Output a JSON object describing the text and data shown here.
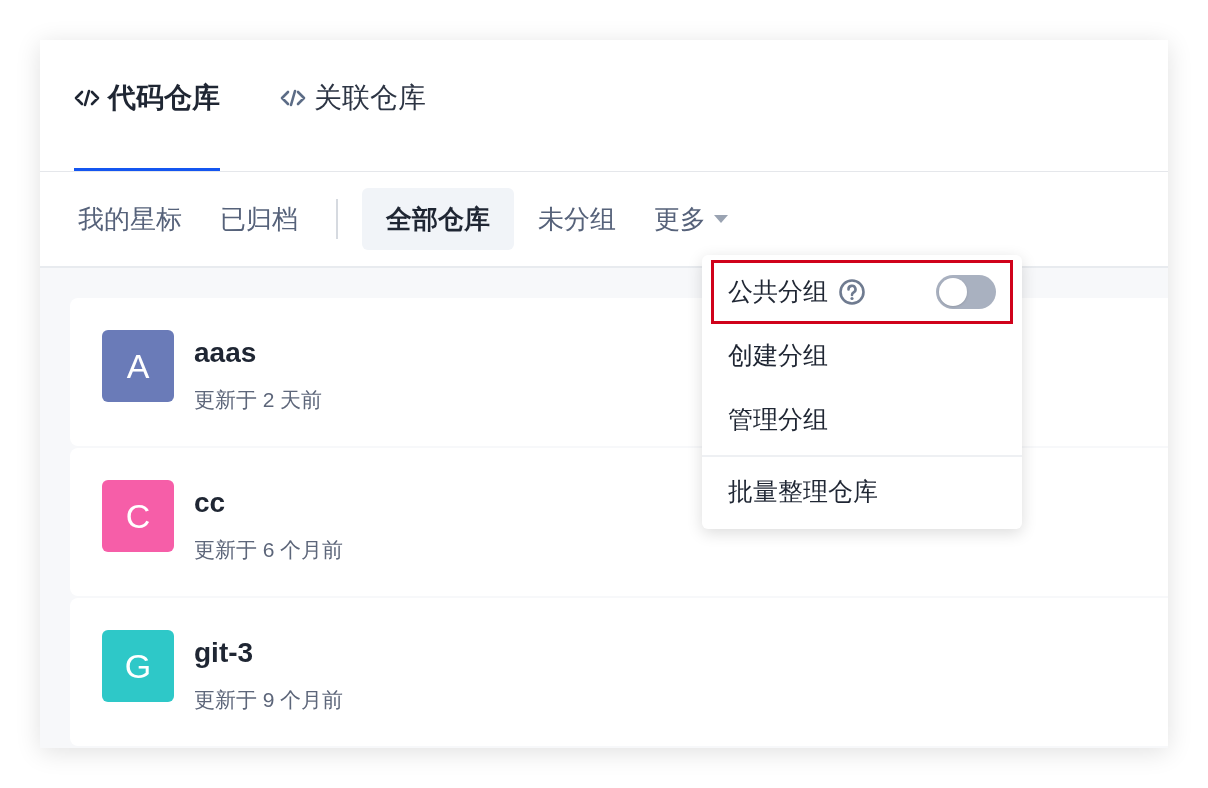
{
  "tabs": [
    {
      "label": "代码仓库",
      "selected": true
    },
    {
      "label": "关联仓库",
      "selected": false
    }
  ],
  "filters": [
    {
      "label": "我的星标",
      "selected": false,
      "kind": "plain"
    },
    {
      "label": "已归档",
      "selected": false,
      "kind": "plain"
    },
    {
      "kind": "divider"
    },
    {
      "label": "全部仓库",
      "selected": true,
      "kind": "plain"
    },
    {
      "label": "未分组",
      "selected": false,
      "kind": "plain"
    },
    {
      "label": "更多",
      "selected": false,
      "kind": "dropdown"
    }
  ],
  "repos": [
    {
      "initial": "A",
      "name": "aaas",
      "updated": "更新于 2 天前",
      "color": "#6a7bb8"
    },
    {
      "initial": "C",
      "name": "cc",
      "updated": "更新于 6 个月前",
      "color": "#f65ea8"
    },
    {
      "initial": "G",
      "name": "git-3",
      "updated": "更新于 9 个月前",
      "color": "#2ec8c8"
    }
  ],
  "menu": [
    {
      "kind": "toggle",
      "label": "公共分组",
      "on": false,
      "highlighted": true
    },
    {
      "kind": "item",
      "label": "创建分组",
      "highlighted": false
    },
    {
      "kind": "item",
      "label": "管理分组",
      "highlighted": false
    },
    {
      "kind": "divider"
    },
    {
      "kind": "item",
      "label": "批量整理仓库",
      "highlighted": false
    }
  ]
}
